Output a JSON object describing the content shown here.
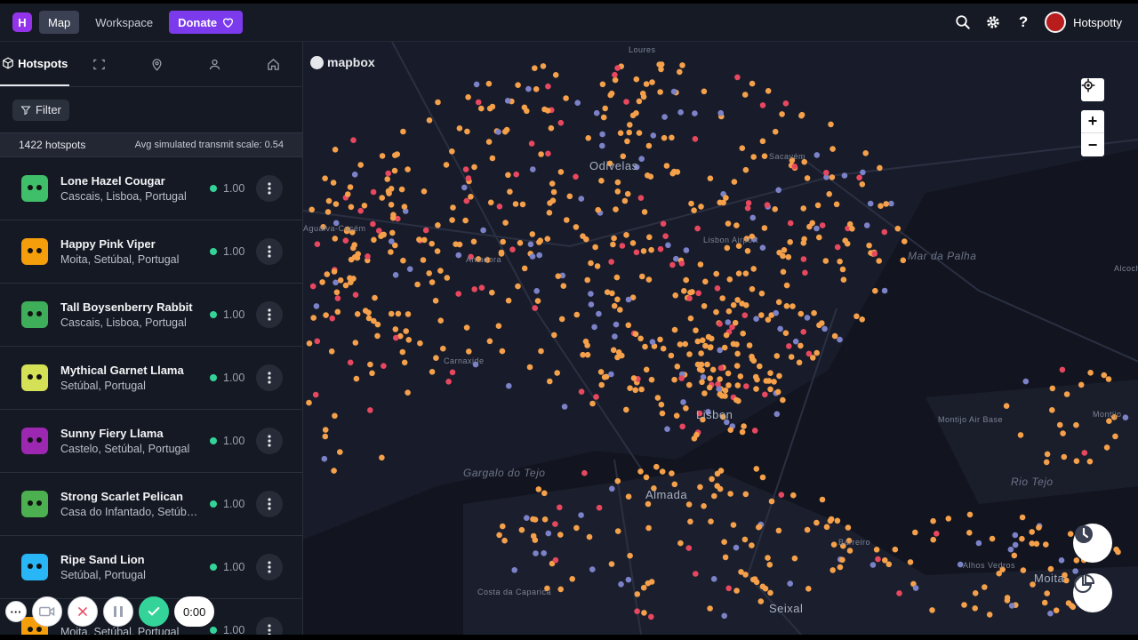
{
  "nav": {
    "logo_letter": "H",
    "map_label": "Map",
    "workspace_label": "Workspace",
    "donate_label": "Donate",
    "username": "Hotspotty"
  },
  "sidebar": {
    "tabs": [
      {
        "label": "Hotspots",
        "icon": "cube-icon"
      },
      {
        "label": "",
        "icon": "scan-icon"
      },
      {
        "label": "",
        "icon": "location-pin-icon"
      },
      {
        "label": "",
        "icon": "user-icon"
      },
      {
        "label": "",
        "icon": "home-icon"
      }
    ],
    "filter_label": "Filter",
    "stats": {
      "count": "1422 hotspots",
      "avg": "Avg simulated transmit scale: 0.54"
    },
    "items": [
      {
        "name": "Lone Hazel Cougar",
        "location": "Cascais, Lisboa, Portugal",
        "scale": "1.00",
        "color": "#3fbf6a"
      },
      {
        "name": "Happy Pink Viper",
        "location": "Moita, Setúbal, Portugal",
        "scale": "1.00",
        "color": "#f59e0b"
      },
      {
        "name": "Tall Boysenberry Rabbit",
        "location": "Cascais, Lisboa, Portugal",
        "scale": "1.00",
        "color": "#3fae5a"
      },
      {
        "name": "Mythical Garnet Llama",
        "location": "Setúbal, Portugal",
        "scale": "1.00",
        "color": "#d4e157"
      },
      {
        "name": "Sunny Fiery Llama",
        "location": "Castelo, Setúbal, Portugal",
        "scale": "1.00",
        "color": "#9c27b0"
      },
      {
        "name": "Strong Scarlet Pelican",
        "location": "Casa do Infantado, Setúbal, Portugal",
        "scale": "1.00",
        "color": "#4caf50"
      },
      {
        "name": "Ripe Sand Lion",
        "location": "Setúbal, Portugal",
        "scale": "1.00",
        "color": "#29b6f6"
      },
      {
        "name": "",
        "location": "Moita, Setúbal, Portugal",
        "scale": "1.00",
        "color": "#f59e0b"
      }
    ]
  },
  "map": {
    "attribution": "mapbox",
    "labels": [
      {
        "text": "Odivelas",
        "big": true
      },
      {
        "text": "Lisbon",
        "big": true
      },
      {
        "text": "Lisbon Airport",
        "big": false
      },
      {
        "text": "Mar da Palha",
        "water": true
      },
      {
        "text": "Montijo Air Base",
        "big": false
      },
      {
        "text": "Almada",
        "big": true
      },
      {
        "text": "Seixal",
        "big": true
      },
      {
        "text": "Barreiro",
        "big": false
      },
      {
        "text": "Moita",
        "big": true
      },
      {
        "text": "Alhos Vedros",
        "big": false
      },
      {
        "text": "Agualva-Cacém",
        "big": false
      },
      {
        "text": "Amadora",
        "big": false
      },
      {
        "text": "Carnaxide",
        "big": false
      },
      {
        "text": "Sacavém",
        "big": false
      },
      {
        "text": "Gargalo do Tejo",
        "water": true
      },
      {
        "text": "Rio Tejo",
        "water": true
      },
      {
        "text": "Montijo",
        "big": false
      },
      {
        "text": "Costa da Caparica",
        "big": false
      },
      {
        "text": "Loures",
        "big": false
      },
      {
        "text": "Alcochete",
        "big": false
      }
    ],
    "zoom_in": "+",
    "zoom_out": "−",
    "dot_colors": {
      "orange": "#f5a04a",
      "red": "#e8485f",
      "blue": "#7c82c8"
    }
  },
  "recorder": {
    "timer": "0:00"
  }
}
